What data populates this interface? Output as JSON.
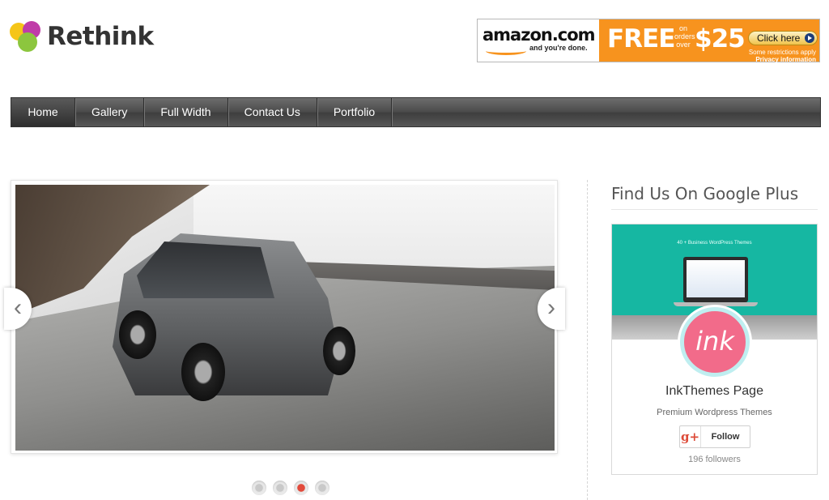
{
  "site": {
    "logo_text": "Rethink"
  },
  "ad": {
    "brand": "amazon.com",
    "tagline": "and you're done.",
    "free": "FREE",
    "on_orders": "on orders over",
    "amount": "$25",
    "cta": "Click here",
    "fine_print": [
      "Some restrictions apply",
      "Privacy information"
    ],
    "colors": {
      "accent": "#f7931e"
    }
  },
  "nav": {
    "items": [
      "Home",
      "Gallery",
      "Full Width",
      "Contact Us",
      "Portfolio"
    ],
    "active": "Home"
  },
  "slider": {
    "image_subject": "Land Rover on coastal mountain road",
    "slide_count": 4,
    "active_slide": 3,
    "prev_icon": "chevron-left-icon",
    "next_icon": "chevron-right-icon"
  },
  "sidebar": {
    "title": "Find Us On Google Plus",
    "card": {
      "banner_text": "40 + Business WordPress Themes",
      "avatar_text": "ink",
      "page_name": "InkThemes Page",
      "subtitle": "Premium Wordpress Themes",
      "follow_label": "Follow",
      "gplus_glyph": "g+",
      "followers": "196 followers",
      "colors": {
        "banner": "#16b7a2",
        "avatar": "#f26b8a",
        "gplus": "#dd4b39"
      }
    }
  }
}
